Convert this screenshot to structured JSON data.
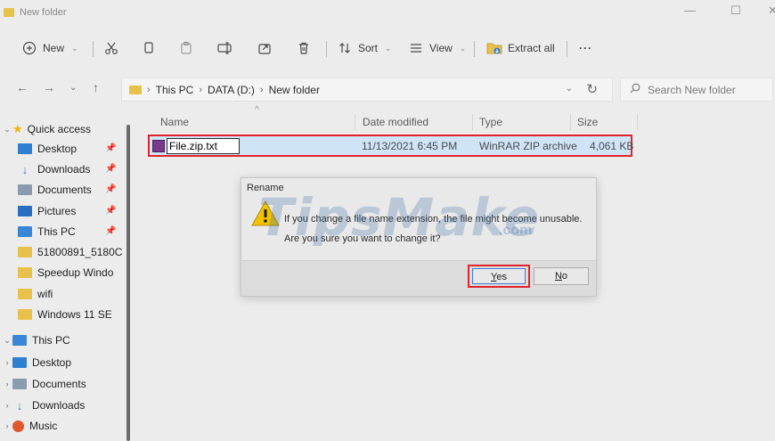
{
  "window": {
    "title": "New folder",
    "controls": {
      "minimize": "—",
      "maximize": "☐",
      "close": "✕"
    }
  },
  "commandbar": {
    "new_label": "New",
    "sort_label": "Sort",
    "view_label": "View",
    "extract_label": "Extract all",
    "more_label": "···"
  },
  "address": {
    "breadcrumb": [
      "This PC",
      "DATA (D:)",
      "New folder"
    ],
    "search_placeholder": "Search New folder"
  },
  "sidebar": {
    "quick_access": "Quick access",
    "quick_items": [
      {
        "label": "Desktop",
        "icon": "desktop-icon"
      },
      {
        "label": "Downloads",
        "icon": "download-icon"
      },
      {
        "label": "Documents",
        "icon": "documents-icon"
      },
      {
        "label": "Pictures",
        "icon": "pictures-icon"
      },
      {
        "label": "This PC",
        "icon": "pc-icon"
      },
      {
        "label": "51800891_5180C",
        "icon": "folder-icon"
      },
      {
        "label": "Speedup Windo",
        "icon": "folder-icon"
      },
      {
        "label": "wifi",
        "icon": "folder-icon"
      },
      {
        "label": "Windows 11 SE",
        "icon": "folder-icon"
      }
    ],
    "this_pc": "This PC",
    "pc_items": [
      {
        "label": "Desktop",
        "icon": "desktop-icon"
      },
      {
        "label": "Documents",
        "icon": "documents-icon"
      },
      {
        "label": "Downloads",
        "icon": "download-icon"
      },
      {
        "label": "Music",
        "icon": "music-icon"
      }
    ]
  },
  "filelist": {
    "columns": {
      "name": "Name",
      "date": "Date modified",
      "type": "Type",
      "size": "Size"
    },
    "rows": [
      {
        "name": "File.zip.txt",
        "date": "11/13/2021 6:45 PM",
        "type": "WinRAR ZIP archive",
        "size": "4,061 KB"
      }
    ]
  },
  "dialog": {
    "title": "Rename",
    "line1": "If you change a file name extension, the file might become unusable.",
    "line2": "Are you sure you want to change it?",
    "yes_mnemonic": "Y",
    "yes_rest": "es",
    "no_mnemonic": "N",
    "no_rest": "o"
  },
  "watermark": {
    "main": "TipsMake",
    "suffix": ".com"
  },
  "colors": {
    "highlight": "#e2242a",
    "selection": "#cfe4f7",
    "folder": "#e8c14a",
    "accent": "#2f7fd0"
  }
}
